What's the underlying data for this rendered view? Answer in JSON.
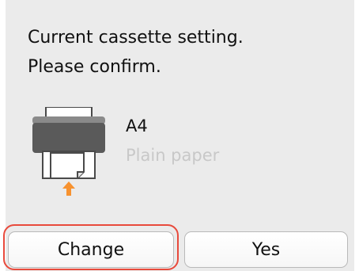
{
  "message": {
    "line1": "Current cassette setting.",
    "line2": "Please confirm."
  },
  "paper": {
    "size": "A4",
    "type": "Plain paper",
    "icon": "printer-cassette-icon"
  },
  "buttons": {
    "change": "Change",
    "yes": "Yes"
  },
  "colors": {
    "background": "#ebebeb",
    "focus_outline": "#e84a3c",
    "arrow": "#f7922f",
    "muted_text": "#c8c8c8"
  }
}
